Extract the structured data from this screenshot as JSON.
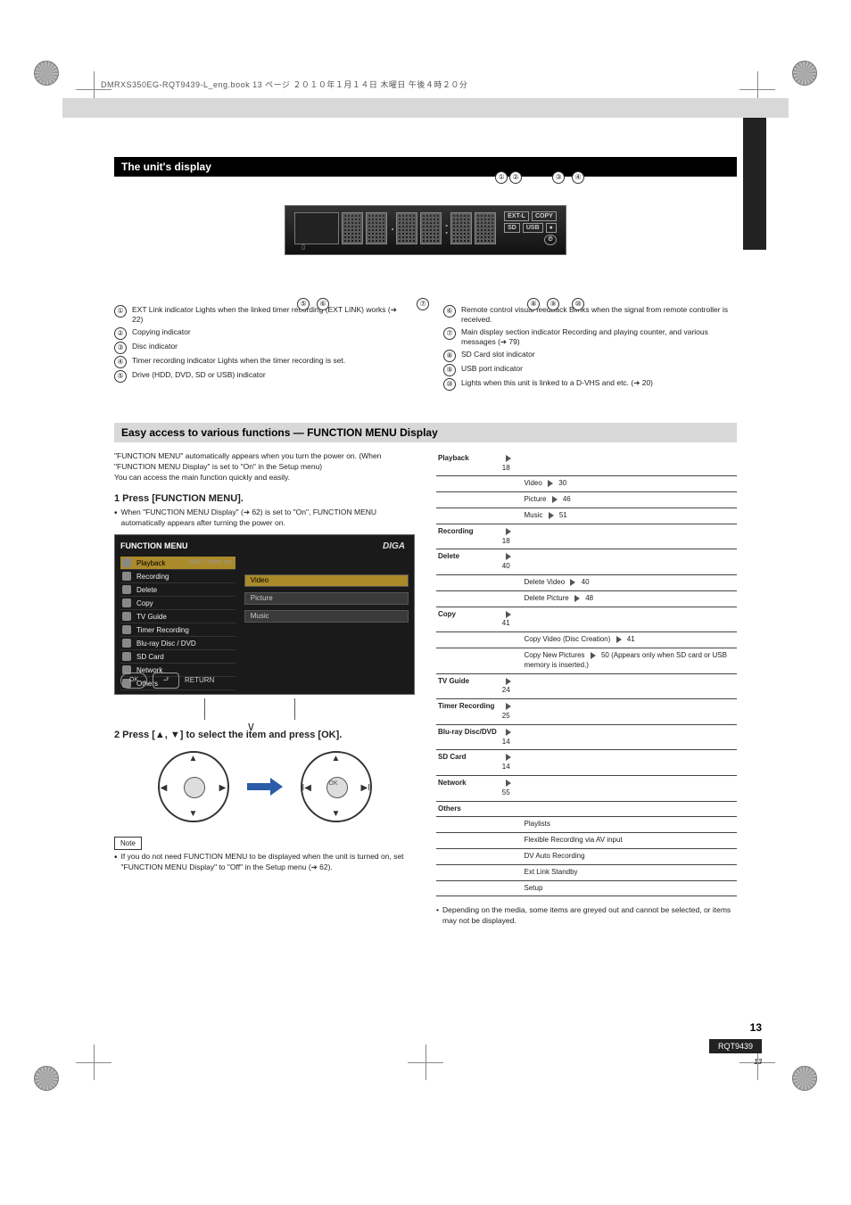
{
  "header_stamp": "DMRXS350EG-RQT9439-L_eng.book  13 ページ  ２０１０年１月１４日  木曜日  午後４時２０分",
  "section_title": "The unit's display",
  "display_labels": {
    "ext_l": "EXT-L",
    "copy": "COPY",
    "sd": "SD",
    "usb": "USB",
    "disc_icon": "●",
    "clock_icon": "⏲"
  },
  "callout_nums_top": [
    "①",
    "②",
    "③",
    "④"
  ],
  "callout_nums_bot": [
    "⑤",
    "⑥",
    "⑦",
    "⑧",
    "⑨",
    "⑩"
  ],
  "legend_left": [
    {
      "n": "①",
      "t": "EXT Link indicator\nLights when the linked timer recording (EXT LINK) works (➔ 22)"
    },
    {
      "n": "②",
      "t": "Copying indicator"
    },
    {
      "n": "③",
      "t": "Disc indicator"
    },
    {
      "n": "④",
      "t": "Timer recording indicator\nLights when the timer recording is set."
    },
    {
      "n": "⑤",
      "t": "Drive (HDD, DVD, SD or USB) indicator"
    }
  ],
  "legend_right": [
    {
      "n": "⑥",
      "t": "Remote control visual feedback\nBlinks when the signal from remote controller is received."
    },
    {
      "n": "⑦",
      "t": "Main display section indicator\nRecording and playing counter, and various messages (➔ 79)"
    },
    {
      "n": "⑧",
      "t": "SD Card slot indicator"
    },
    {
      "n": "⑨",
      "t": "USB port indicator"
    },
    {
      "n": "⑩",
      "t": "Lights when this unit is linked to a D-VHS and etc. (➔ 20)"
    }
  ],
  "easy_section_title": "Easy access to various functions — FUNCTION MENU Display",
  "intro": "\"FUNCTION MENU\" automatically appears when you turn the power on. (When \"FUNCTION MENU Display\" is set to \"On\" in the Setup menu)\nYou can access the main function quickly and easily.",
  "step1_title": "1 Press [FUNCTION MENU].",
  "step1_bullet": "When \"FUNCTION MENU Display\" (➔ 62) is set to \"On\", FUNCTION MENU automatically appears after turning the power on.",
  "menu_title": "FUNCTION MENU",
  "menu_items": [
    {
      "label": "Playback",
      "sub": "HDD: Timer rec."
    },
    {
      "label": "Recording",
      "sub": ""
    },
    {
      "label": "Delete",
      "sub": ""
    },
    {
      "label": "Copy",
      "sub": ""
    },
    {
      "label": "TV Guide",
      "sub": ""
    },
    {
      "label": "Timer Recording",
      "sub": ""
    },
    {
      "label": "Blu-ray Disc / DVD",
      "sub": ""
    },
    {
      "label": "SD Card",
      "sub": ""
    },
    {
      "label": "Network",
      "sub": ""
    },
    {
      "label": "Others",
      "sub": ""
    }
  ],
  "menu_right_options": [
    "Video",
    "Picture",
    "Music"
  ],
  "menu_hint_ok": "OK",
  "menu_hint_return": "RETURN",
  "menu_diga": "DIGA",
  "step2": "2 Press [▲, ▼] to select the item and press [OK].",
  "step2_note": "If you do not need FUNCTION MENU to be displayed when the unit is turned on, set \"FUNCTION MENU Display\" to \"Off\" in the Setup menu (➔ 62).",
  "note_label": "Note",
  "fm_rows": [
    {
      "k": "Playback",
      "a": "(➔ 18)",
      "v": ""
    },
    {
      "k": "",
      "a": "",
      "v": "Video  (➔ 30)"
    },
    {
      "k": "",
      "a": "",
      "v": "Picture  (➔ 46)"
    },
    {
      "k": "",
      "a": "",
      "v": "Music  (➔ 51)"
    },
    {
      "k": "Recording",
      "a": "(➔ 18)",
      "v": ""
    },
    {
      "k": "Delete",
      "a": "(➔ 40)",
      "v": ""
    },
    {
      "k": "",
      "a": "",
      "v": "Delete Video  (➔ 40)"
    },
    {
      "k": "",
      "a": "",
      "v": "Delete Picture  (➔ 48)"
    },
    {
      "k": "Copy",
      "a": "(➔ 41)",
      "v": ""
    },
    {
      "k": "",
      "a": "",
      "v": "Copy Video (Disc Creation)  (➔ 41)"
    },
    {
      "k": "",
      "a": "",
      "v": "Copy New Pictures (➔ 50) (Appears only when SD card or USB memory is inserted.)"
    },
    {
      "k": "TV Guide",
      "a": "(➔ 24)",
      "v": ""
    },
    {
      "k": "Timer Recording",
      "a": "(➔ 25)",
      "v": ""
    },
    {
      "k": "Blu-ray Disc/DVD",
      "a": "(➔ 14)",
      "v": ""
    },
    {
      "k": "SD Card",
      "a": "(➔ 14)",
      "v": ""
    },
    {
      "k": "Network",
      "a": "(➔ 55)",
      "v": ""
    },
    {
      "k": "Others",
      "a": "",
      "v": ""
    },
    {
      "k": "",
      "a": "",
      "v": "Playlists"
    },
    {
      "k": "",
      "a": "",
      "v": "Flexible Recording via AV input"
    },
    {
      "k": "",
      "a": "",
      "v": "DV Auto Recording"
    },
    {
      "k": "",
      "a": "",
      "v": "Ext Link Standby"
    },
    {
      "k": "",
      "a": "",
      "v": "Setup"
    }
  ],
  "final_note": "Depending on the media, some items are greyed out and cannot be selected, or items may not be displayed.",
  "page_code": "RQT9439",
  "page_num_bold": "13",
  "page_num_small": "13"
}
